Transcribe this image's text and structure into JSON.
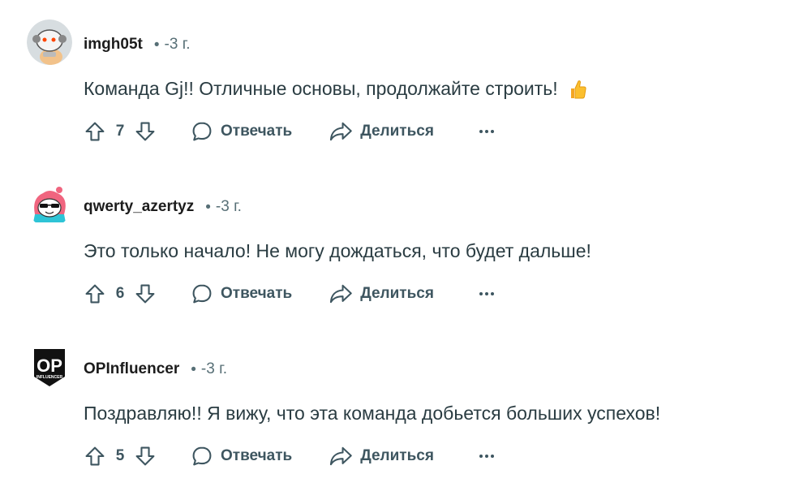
{
  "comments": [
    {
      "username": "imgh05t",
      "time": "3 г.",
      "separator": "•",
      "text": "Команда Gj!! Отличные основы, продолжайте строить!",
      "emoji_icon": "thumbs-up-emoji",
      "votes": "7",
      "reply_label": "Отвечать",
      "share_label": "Делиться",
      "avatar_icon": "snoo-astronaut-avatar"
    },
    {
      "username": "qwerty_azertyz",
      "time": "3 г.",
      "separator": "•",
      "text": "Это только начало! Не могу дождаться, что будет дальше!",
      "votes": "6",
      "reply_label": "Отвечать",
      "share_label": "Делиться",
      "avatar_icon": "snoo-sunglasses-avatar"
    },
    {
      "username": "OPInfluencer",
      "time": "3 г.",
      "separator": "•",
      "text": "Поздравляю!! Я вижу, что эта команда добьется больших успехов!",
      "votes": "5",
      "reply_label": "Отвечать",
      "share_label": "Делиться",
      "avatar_icon": "op-influencer-logo-avatar",
      "avatar_logo_text": "OP",
      "avatar_logo_subtext": "INFLUENCER"
    }
  ],
  "colors": {
    "text": "#1c1c1c",
    "meta": "#576f76",
    "action": "#3e5660"
  }
}
